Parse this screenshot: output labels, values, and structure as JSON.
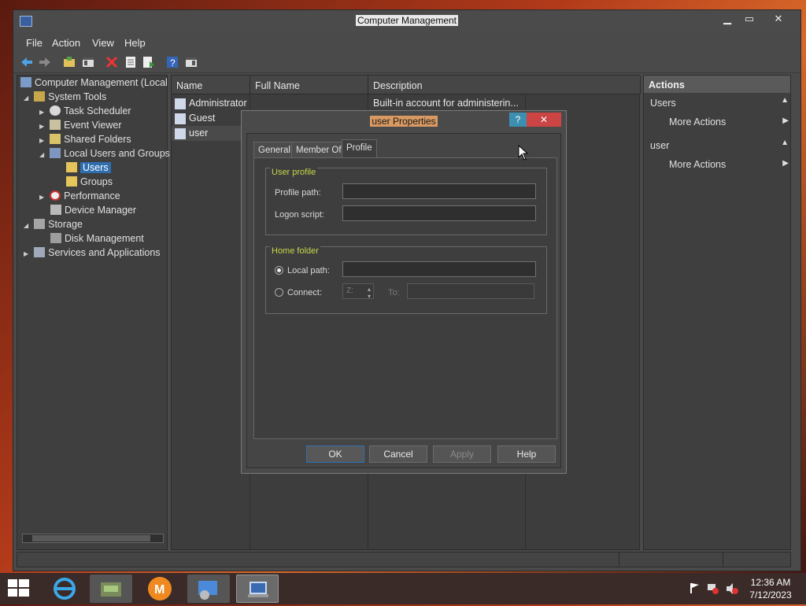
{
  "window": {
    "title": "Computer Management",
    "minimize": "▁",
    "maximize": "▭",
    "close": "✕"
  },
  "menu": [
    "File",
    "Action",
    "View",
    "Help"
  ],
  "tree": {
    "root": "Computer Management (Local",
    "system_tools": "System Tools",
    "task_scheduler": "Task Scheduler",
    "event_viewer": "Event Viewer",
    "shared_folders": "Shared Folders",
    "local_users": "Local Users and Groups",
    "users": "Users",
    "groups": "Groups",
    "performance": "Performance",
    "device_manager": "Device Manager",
    "storage": "Storage",
    "disk_management": "Disk Management",
    "services": "Services and Applications"
  },
  "list": {
    "columns": [
      "Name",
      "Full Name",
      "Description"
    ],
    "rows": [
      {
        "name": "Administrator",
        "full_name": "",
        "description": "Built-in account for administerin..."
      },
      {
        "name": "Guest",
        "full_name": "",
        "description": ""
      },
      {
        "name": "user",
        "full_name": "",
        "description": ""
      }
    ]
  },
  "actions": {
    "header": "Actions",
    "section1": "Users",
    "more1": "More Actions",
    "section2": "user",
    "more2": "More Actions"
  },
  "dialog": {
    "title": "user Properties",
    "help": "?",
    "close": "✕",
    "tabs": [
      "General",
      "Member Of",
      "Profile"
    ],
    "user_profile_legend": "User profile",
    "profile_path_label": "Profile path:",
    "profile_path_value": "",
    "logon_script_label": "Logon script:",
    "logon_script_value": "",
    "home_folder_legend": "Home folder",
    "local_path_label": "Local path:",
    "local_path_value": "",
    "connect_label": "Connect:",
    "drive_value": "Z:",
    "to_label": "To:",
    "to_value": "",
    "buttons": {
      "ok": "OK",
      "cancel": "Cancel",
      "apply": "Apply",
      "help": "Help"
    }
  },
  "taskbar": {
    "time": "12:36 AM",
    "date": "7/12/2023"
  },
  "colors": {
    "dialog_title_highlight": "#d89a62",
    "legend": "#c8d64a",
    "accent": "#2f6fb0"
  }
}
